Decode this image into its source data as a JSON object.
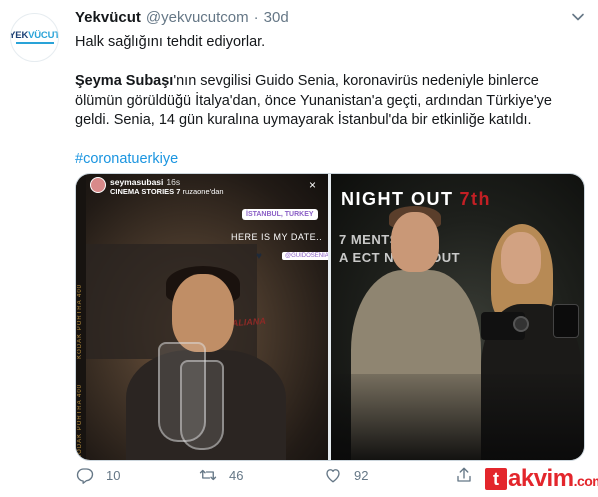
{
  "tweet": {
    "author_name": "Yekvücut",
    "handle": "@yekvucutcom",
    "separator": "·",
    "time": "30d",
    "line1": "Halk sağlığını tehdit ediyorlar.",
    "para2_bold": "Şeyma Subaşı",
    "para2_rest": "'nın sevgilisi Guido Senia, koronavirüs nedeniyle binlerce ölümün görüldüğü İtalya'dan, önce Yunanistan'a geçti, ardından Türkiye'ye geldi. Senia, 14 gün kuralına uymayarak İstanbul'da bir etkinliğe katıldı.",
    "hashtag": "#coronatuerkiye"
  },
  "avatar": {
    "logo_part1": "YEK",
    "logo_part2": "VÜCUT"
  },
  "media": {
    "left": {
      "story_user": "seymasubasi",
      "story_age": "16s",
      "story_source_bold": "CINEMA STORIES 7",
      "story_source_rest": "ruzaone'dan",
      "close_icon": "×",
      "location_sticker": "İSTANBUL, TURKEY",
      "caption": "HERE IS MY DATE..",
      "heart_icon": "♥",
      "mention_sticker": "@GUIDOSENIA",
      "film_text": "KODAK PORTRA 400",
      "poster_text": "ALE ITALIANA"
    },
    "right": {
      "banner_white": "NIGHT OUT",
      "banner_red": "7th",
      "banner_line2": "7  MENTS OF",
      "banner_line3": "A    ECT NIGHT OUT"
    }
  },
  "actions": {
    "reply_count": "10",
    "retweet_count": "46",
    "like_count": "92"
  },
  "watermark": {
    "letter": "t",
    "rest": "akvim",
    "suffix": ".com"
  },
  "colors": {
    "link": "#1b95e0",
    "secondary_text": "#657786",
    "watermark_red": "#e3262c"
  }
}
